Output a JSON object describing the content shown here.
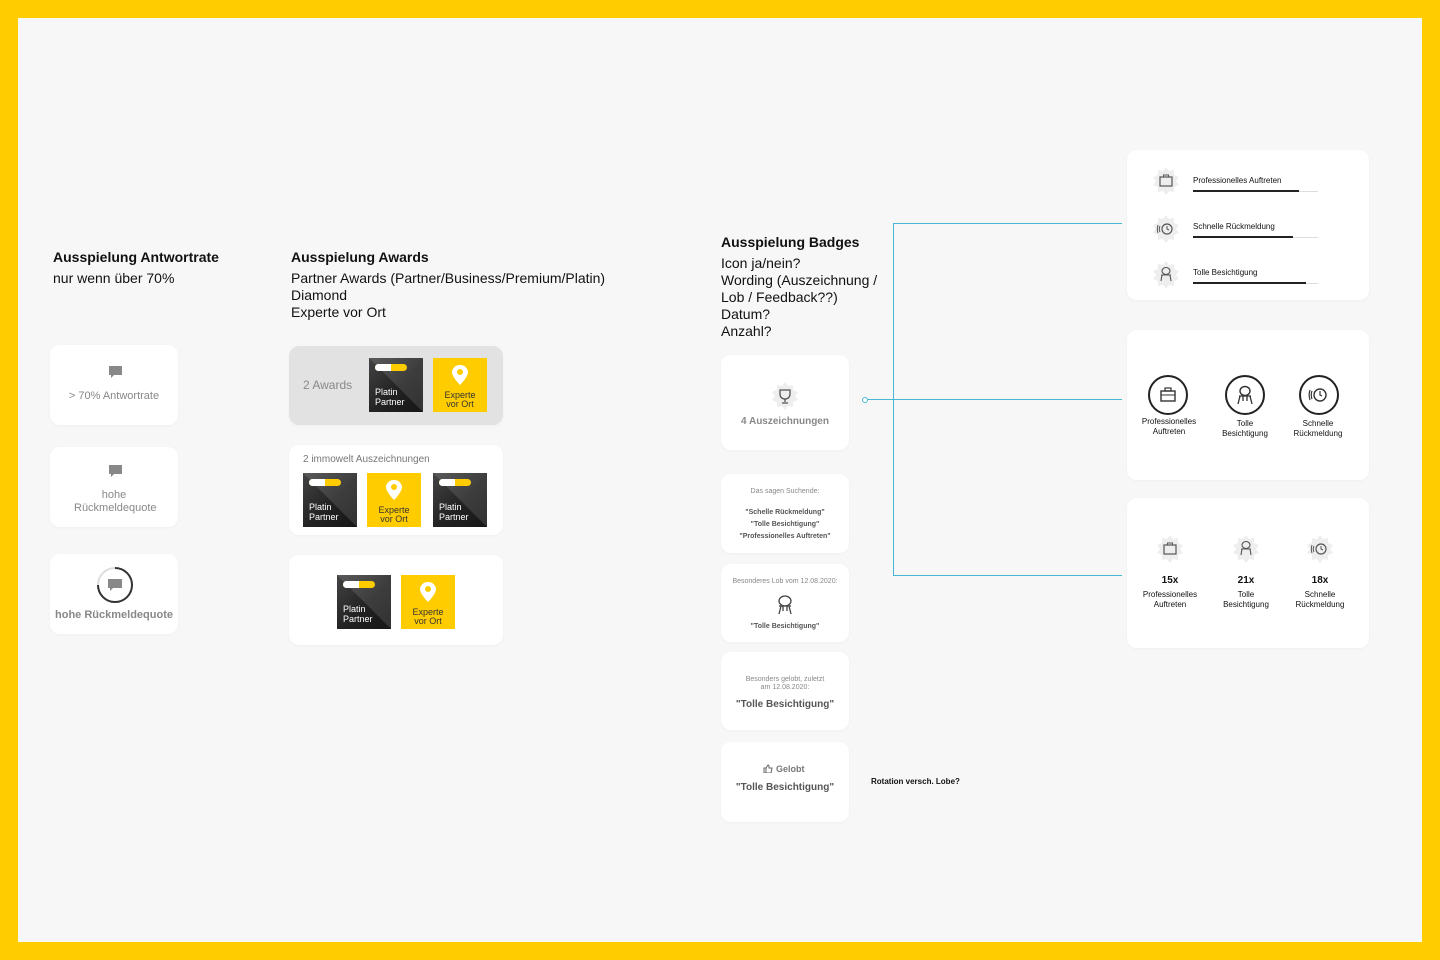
{
  "col1": {
    "title": "Ausspielung Antwortrate",
    "line1": "nur wenn über 70%",
    "card1": "> 70% Antwortrate",
    "card2": "hohe Rückmeldequote",
    "card3": "hohe Rückmeldequote"
  },
  "col2": {
    "title": "Ausspielung Awards",
    "lines": [
      "Partner Awards (Partner/Business/Premium/Platin)",
      "Diamond",
      "Experte vor Ort"
    ],
    "card1_label": "2 Awards",
    "card2_label": "2 immowelt Auszeichnungen",
    "badge_platin": [
      "Platin",
      "Partner"
    ],
    "badge_experte": [
      "Experte",
      "vor Ort"
    ]
  },
  "col3": {
    "title": "Ausspielung Badges",
    "lines": [
      "Icon ja/nein?",
      "Wording (Auszeichnung /",
      "Lob / Feedback??)",
      "Datum?",
      "Anzahl?"
    ],
    "card1": "4 Auszeichnungen",
    "card2": {
      "heading": "Das sagen Suchende:",
      "quotes": [
        "\"Schelle Rückmeldung\"",
        "\"Tolle Besichtigung\"",
        "\"Professionelles Auftreten\""
      ]
    },
    "card3": {
      "heading": "Besonderes Lob vom 12.08.2020:",
      "quote": "\"Tolle Besichtigung\""
    },
    "card4": {
      "heading1": "Besonders gelobt, zuletzt",
      "heading2": "am 12.08.2020:",
      "quote": "\"Tolle Besichtigung\""
    },
    "card5": {
      "label": "Gelobt",
      "quote": "\"Tolle Besichtigung\""
    },
    "note": "Rotation versch. Lobe?"
  },
  "col4": {
    "list": [
      {
        "label": "Professionelles Auftreten",
        "icon": "briefcase-icon",
        "fill": 0.85
      },
      {
        "label": "Schnelle Rückmeldung",
        "icon": "clock-icon",
        "fill": 0.8
      },
      {
        "label": "Tolle Besichtigung",
        "icon": "chair-icon",
        "fill": 0.9
      }
    ],
    "circles": [
      {
        "l1": "Professionelles",
        "l2": "Auftreten",
        "icon": "briefcase-icon"
      },
      {
        "l1": "Tolle",
        "l2": "Besichtigung",
        "icon": "chair-icon"
      },
      {
        "l1": "Schnelle",
        "l2": "Rückmeldung",
        "icon": "clock-icon"
      }
    ],
    "counts": [
      {
        "count": "15x",
        "l1": "Professionelles",
        "l2": "Auftreten",
        "icon": "briefcase-icon"
      },
      {
        "count": "21x",
        "l1": "Tolle",
        "l2": "Besichtigung",
        "icon": "chair-icon"
      },
      {
        "count": "18x",
        "l1": "Schnelle",
        "l2": "Rückmeldung",
        "icon": "clock-icon"
      }
    ]
  },
  "colors": {
    "frame": "#FFCC00",
    "connector": "#49B8D4",
    "badge_yellow": "#FFCC00"
  }
}
